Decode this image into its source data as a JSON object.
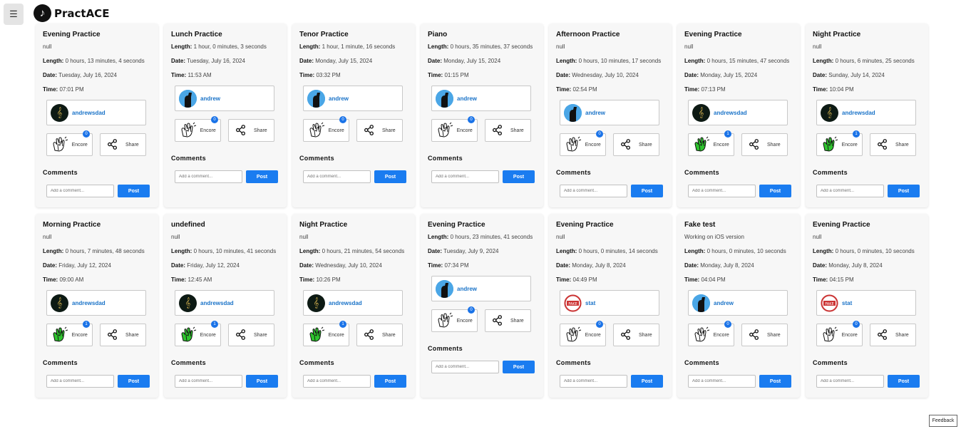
{
  "app": {
    "name": "PractACE",
    "menu_icon": "☰",
    "logo_icon": "♪",
    "feedback_label": "Feedback"
  },
  "labels": {
    "length": "Length:",
    "date": "Date:",
    "time": "Time:",
    "encore": "Encore",
    "share": "Share",
    "comments": "Comments",
    "comment_placeholder": "Add a comment...",
    "post": "Post"
  },
  "cards": [
    {
      "title": "Evening Practice",
      "description": "null",
      "length": "0 hours, 13 minutes, 4 seconds",
      "date": "Tuesday, July 16, 2024",
      "time": "07:01 PM",
      "user": "andrewsdad",
      "avatar": "music",
      "encore_active": false,
      "encore_count": "0"
    },
    {
      "title": "Lunch Practice",
      "description": "",
      "length": "1 hour, 0 minutes, 3 seconds",
      "date": "Tuesday, July 16, 2024",
      "time": "11:53 AM",
      "user": "andrew",
      "avatar": "andrew",
      "encore_active": false,
      "encore_count": "0"
    },
    {
      "title": "Tenor Practice",
      "description": "",
      "length": "1 hour, 1 minute, 16 seconds",
      "date": "Monday, July 15, 2024",
      "time": "03:32 PM",
      "user": "andrew",
      "avatar": "andrew",
      "encore_active": false,
      "encore_count": "0"
    },
    {
      "title": "Piano",
      "description": "",
      "length": "0 hours, 35 minutes, 37 seconds",
      "date": "Monday, July 15, 2024",
      "time": "01:15 PM",
      "user": "andrew",
      "avatar": "andrew",
      "encore_active": false,
      "encore_count": "0"
    },
    {
      "title": "Afternoon Practice",
      "description": "null",
      "length": "0 hours, 10 minutes, 17 seconds",
      "date": "Wednesday, July 10, 2024",
      "time": "02:54 PM",
      "user": "andrew",
      "avatar": "andrew",
      "encore_active": false,
      "encore_count": "0"
    },
    {
      "title": "Evening Practice",
      "description": "null",
      "length": "0 hours, 15 minutes, 47 seconds",
      "date": "Monday, July 15, 2024",
      "time": "07:13 PM",
      "user": "andrewsdad",
      "avatar": "music",
      "encore_active": true,
      "encore_count": "1"
    },
    {
      "title": "Night Practice",
      "description": "null",
      "length": "0 hours, 6 minutes, 25 seconds",
      "date": "Sunday, July 14, 2024",
      "time": "10:04 PM",
      "user": "andrewsdad",
      "avatar": "music",
      "encore_active": true,
      "encore_count": "1"
    },
    {
      "title": "Morning Practice",
      "description": "null",
      "length": "0 hours, 7 minutes, 48 seconds",
      "date": "Friday, July 12, 2024",
      "time": "09:00 AM",
      "user": "andrewsdad",
      "avatar": "music",
      "encore_active": true,
      "encore_count": "1"
    },
    {
      "title": "undefined",
      "description": "null",
      "length": "0 hours, 10 minutes, 41 seconds",
      "date": "Friday, July 12, 2024",
      "time": "12:45 AM",
      "user": "andrewsdad",
      "avatar": "music",
      "encore_active": true,
      "encore_count": "1"
    },
    {
      "title": "Night Practice",
      "description": "null",
      "length": "0 hours, 21 minutes, 54 seconds",
      "date": "Wednesday, July 10, 2024",
      "time": "10:26 PM",
      "user": "andrewsdad",
      "avatar": "music",
      "encore_active": true,
      "encore_count": "1"
    },
    {
      "title": "Evening Practice",
      "description": "",
      "length": "0 hours, 23 minutes, 41 seconds",
      "date": "Tuesday, July 9, 2024",
      "time": "07:34 PM",
      "user": "andrew",
      "avatar": "andrew",
      "encore_active": false,
      "encore_count": "0"
    },
    {
      "title": "Evening Practice",
      "description": "null",
      "length": "0 hours, 0 minutes, 14 seconds",
      "date": "Monday, July 8, 2024",
      "time": "04:49 PM",
      "user": "stat",
      "avatar": "stat",
      "encore_active": false,
      "encore_count": "0"
    },
    {
      "title": "Fake test",
      "description": "Working on iOS version",
      "length": "0 hours, 0 minutes, 10 seconds",
      "date": "Monday, July 8, 2024",
      "time": "04:04 PM",
      "user": "andrew",
      "avatar": "andrew",
      "encore_active": false,
      "encore_count": "0"
    },
    {
      "title": "Evening Practice",
      "description": "null",
      "length": "0 hours, 0 minutes, 10 seconds",
      "date": "Monday, July 8, 2024",
      "time": "04:15 PM",
      "user": "stat",
      "avatar": "stat",
      "encore_active": false,
      "encore_count": "0"
    }
  ]
}
